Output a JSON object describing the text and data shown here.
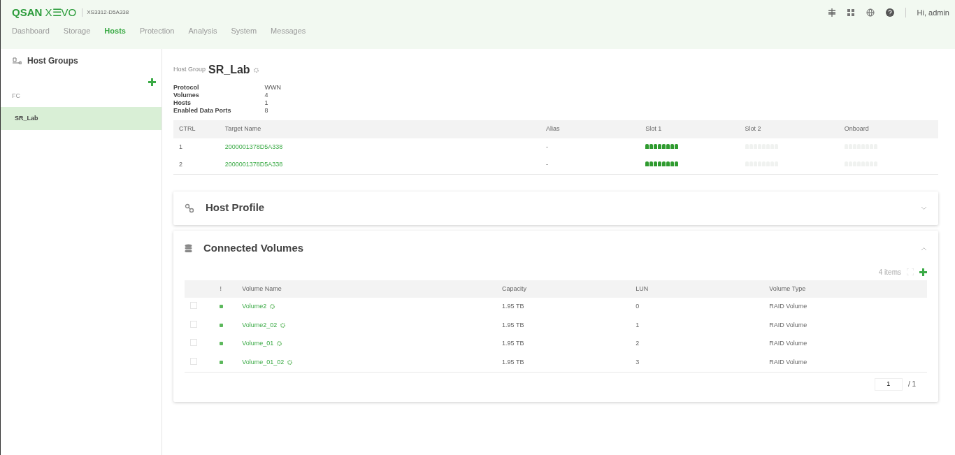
{
  "brand": {
    "logo_bold": "QSAN",
    "logo_light": "X☰VO",
    "device": "XS3312-D5A338"
  },
  "user": {
    "greeting": "Hi, admin"
  },
  "nav": [
    {
      "label": "Dashboard",
      "selected": false
    },
    {
      "label": "Storage",
      "selected": false
    },
    {
      "label": "Hosts",
      "selected": true
    },
    {
      "label": "Protection",
      "selected": false
    },
    {
      "label": "Analysis",
      "selected": false
    },
    {
      "label": "System",
      "selected": false
    },
    {
      "label": "Messages",
      "selected": false
    }
  ],
  "sidebar": {
    "title": "Host Groups",
    "groups": [
      {
        "label": "FC",
        "items": [
          {
            "label": "SR_Lab",
            "selected": true
          }
        ]
      }
    ]
  },
  "host_group": {
    "caption": "Host Group",
    "name": "SR_Lab",
    "properties": [
      {
        "label": "Protocol",
        "value": "WWN"
      },
      {
        "label": "Volumes",
        "value": "4"
      },
      {
        "label": "Hosts",
        "value": "1"
      },
      {
        "label": "Enabled Data Ports",
        "value": "8"
      }
    ]
  },
  "targets": {
    "columns": [
      "CTRL",
      "Target Name",
      "Alias",
      "Slot 1",
      "Slot 2",
      "Onboard"
    ],
    "rows": [
      {
        "ctrl": "1",
        "target_name": "2000001378D5A338",
        "alias": "-",
        "slot_1_active": true,
        "slot_2_active": false,
        "onboard_active": false
      },
      {
        "ctrl": "2",
        "target_name": "2000001378D5A338",
        "alias": "-",
        "slot_1_active": true,
        "slot_2_active": false,
        "onboard_active": false
      }
    ]
  },
  "panels": [
    {
      "kind": "profile",
      "title": "Host Profile",
      "expanded": false
    },
    {
      "kind": "volumes",
      "title": "Connected Volumes",
      "expanded": true
    }
  ],
  "volumes": {
    "count": "4 items",
    "columns": [
      "!",
      "Volume Name",
      "Capacity",
      "LUN",
      "Volume Type"
    ],
    "rows": [
      {
        "checked": false,
        "color": "#5cb85c",
        "name": "Volume2",
        "capacity": "1.95 TB",
        "lun": "0",
        "type": "RAID Volume"
      },
      {
        "checked": false,
        "color": "#5cb85c",
        "name": "Volume2_02",
        "capacity": "1.95 TB",
        "lun": "1",
        "type": "RAID Volume"
      },
      {
        "checked": false,
        "color": "#5cb85c",
        "name": "Volume_01",
        "capacity": "1.95 TB",
        "lun": "2",
        "type": "RAID Volume"
      },
      {
        "checked": false,
        "color": "#5cb85c",
        "name": "Volume_01_02",
        "capacity": "1.95 TB",
        "lun": "3",
        "type": "RAID Volume"
      }
    ],
    "page": "1",
    "pages": "/ 1"
  }
}
